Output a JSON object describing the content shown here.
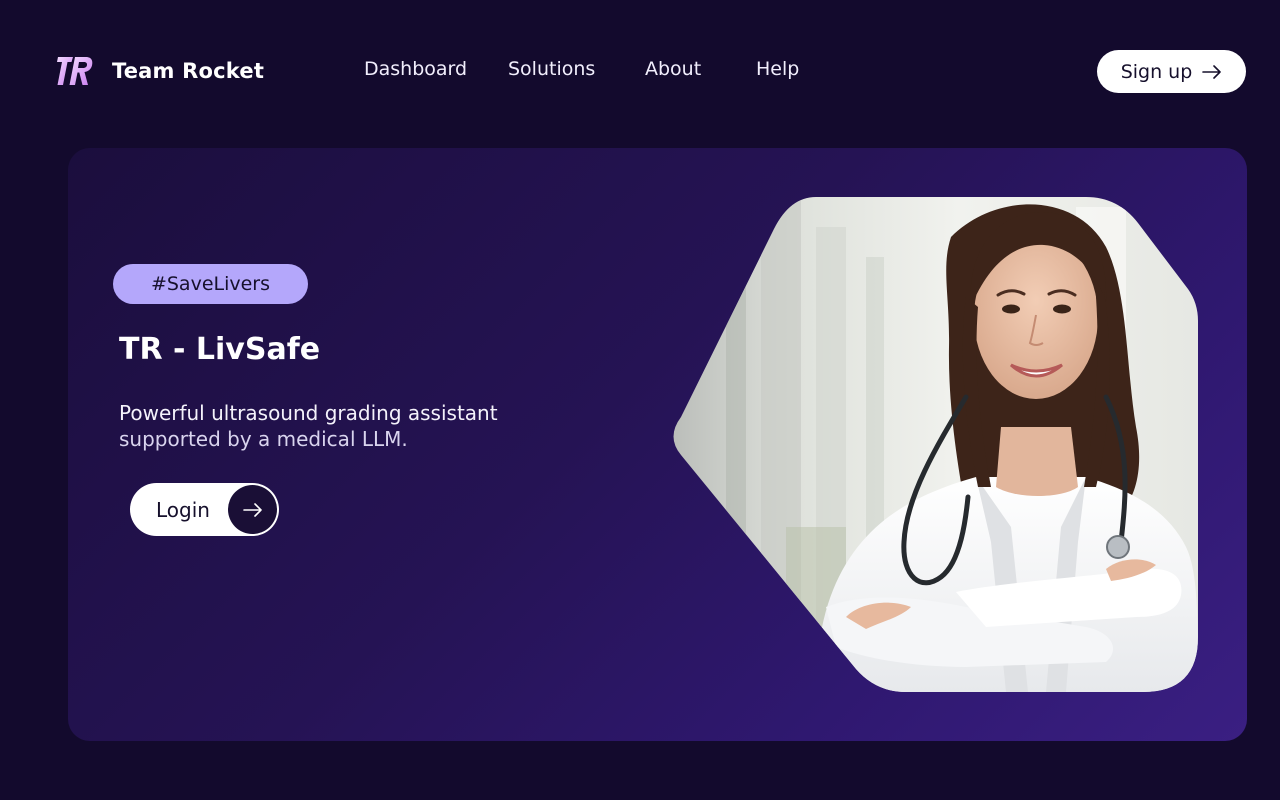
{
  "brand": {
    "logo_text": "TR",
    "name": "Team Rocket"
  },
  "nav": {
    "items": [
      "Dashboard",
      "Solutions",
      "About",
      "Help"
    ]
  },
  "header": {
    "signup_label": "Sign up"
  },
  "hero": {
    "tag": "#SaveLivers",
    "title": "TR - LivSafe",
    "subtitle_line1": "Powerful ultrasound grading assistant",
    "subtitle_line2": "supported by a medical LLM.",
    "login_label": "Login",
    "image_icon": "doctor-portrait"
  },
  "colors": {
    "page_bg": "#130a2d",
    "hero_bg_start": "#1b0e3d",
    "hero_bg_end": "#3a1f82",
    "tag_bg": "#b4a7fb",
    "logo_accent": "#c97bf0"
  }
}
